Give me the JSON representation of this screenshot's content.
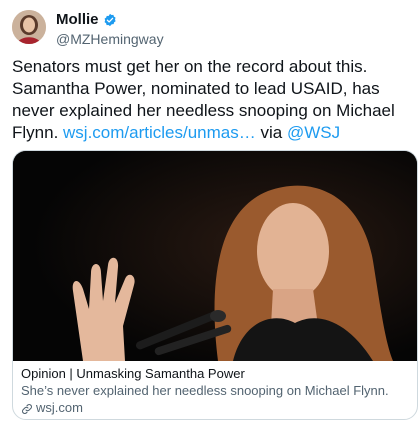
{
  "author": {
    "display_name": "Mollie",
    "handle": "@MZHemingway",
    "verified": true
  },
  "tweet": {
    "text_parts": {
      "line_body": "Senators must get her on the record about this. Samantha Power, nominated to lead USAID, has never explained her needless snooping on Michael Flynn. ",
      "link": "wsj.com/articles/unmas…",
      "via": " via ",
      "mention": "@WSJ"
    }
  },
  "card": {
    "title": "Opinion | Unmasking Samantha Power",
    "description": "She’s never explained her needless snooping on Michael Flynn.",
    "domain": "wsj.com"
  },
  "colors": {
    "link": "#1d9bf0",
    "secondary_text": "#536471",
    "card_border": "#cfd9de"
  },
  "icons": {
    "verified": "verified-badge-icon",
    "card_link": "link-icon"
  }
}
